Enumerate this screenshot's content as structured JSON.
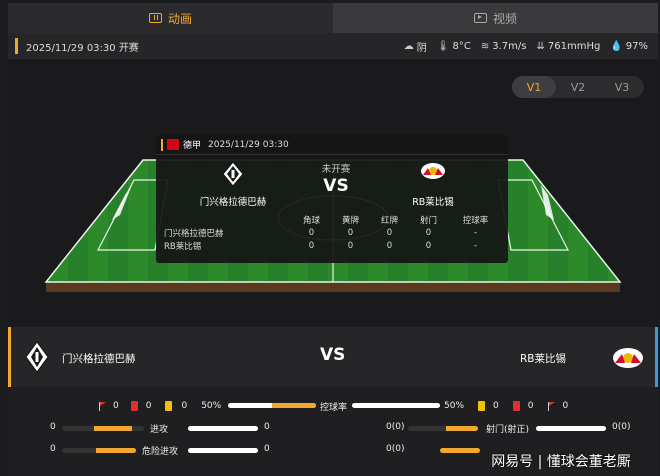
{
  "tabs": [
    {
      "label": "动画",
      "icon": "animation-icon",
      "active": true
    },
    {
      "label": "视频",
      "icon": "video-icon",
      "active": false
    }
  ],
  "info": {
    "kickoff": "2025/11/29 03:30 开赛",
    "weather": {
      "condition": "阴",
      "temperature": "8°C",
      "wind": "3.7m/s",
      "pressure": "761mmHg",
      "humidity": "97%"
    }
  },
  "views": [
    "V1",
    "V2",
    "V3"
  ],
  "active_view": "V1",
  "popup": {
    "league": "德甲",
    "datetime": "2025/11/29 03:30",
    "status": "未开赛",
    "vs": "VS",
    "home": "门兴格拉德巴赫",
    "away": "RB莱比锡",
    "stat_headers": [
      "角球",
      "黄牌",
      "红牌",
      "射门",
      "控球率"
    ],
    "rows": [
      {
        "team": "门兴格拉德巴赫",
        "values": [
          "0",
          "0",
          "0",
          "0",
          "-"
        ]
      },
      {
        "team": "RB莱比锡",
        "values": [
          "0",
          "0",
          "0",
          "0",
          "-"
        ]
      }
    ]
  },
  "match": {
    "home": "门兴格拉德巴赫",
    "away": "RB莱比锡",
    "vs": "VS",
    "home_corners": "0",
    "home_red": "0",
    "home_yellow": "0",
    "home_possession": "50%",
    "away_possession": "50%",
    "away_yellow": "0",
    "away_red": "0",
    "away_corners": "0",
    "possession_label": "控球率",
    "possession_home_fraction": 0.5,
    "attack": {
      "label": "进攻",
      "home": "0",
      "away": "0",
      "home_fraction": 0.5
    },
    "dangerous": {
      "label": "危险进攻",
      "home": "0",
      "away": "0",
      "home_fraction": 0.5
    },
    "shots": {
      "label": "射门(射正)",
      "home": "0(0)",
      "away": "0(0)",
      "home_fraction": 0.5
    },
    "extra_home": "0(0)",
    "extra_away": "0"
  },
  "watermark": "网易号 | 懂球会董老厮",
  "colors": {
    "accent": "#f0a830",
    "away_accent": "#3a9ad9",
    "pitch": "#2f8a2a"
  }
}
